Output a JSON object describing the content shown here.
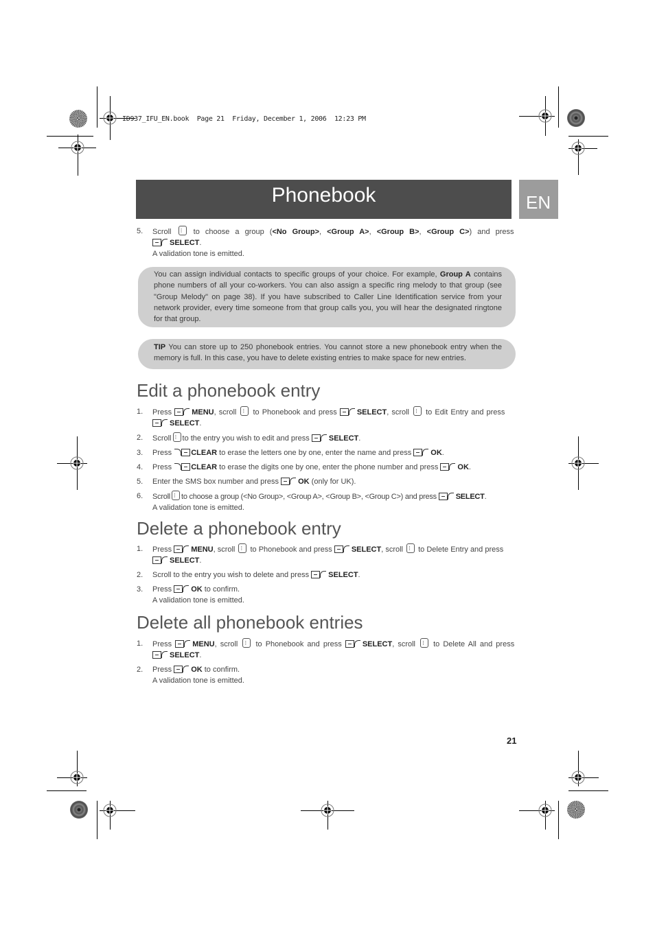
{
  "print_header": {
    "file": "ID937_IFU_EN.book",
    "page": "Page 21",
    "date": "Friday, December 1, 2006",
    "time": "12:23 PM"
  },
  "banner": {
    "title": "Phonebook",
    "lang_tab": "EN"
  },
  "keys": {
    "left_softkey_icon": "left-softkey-icon",
    "right_softkey_icon": "right-softkey-icon",
    "scroll_icon": "scroll-key-icon"
  },
  "intro_step": {
    "num": "5.",
    "t1": "Scroll",
    "t2": "to choose a group (",
    "g1": "<No Group>",
    "sep1": ", ",
    "g2": "<Group A>",
    "sep2": ", ",
    "g3": "<Group B>",
    "sep3": ", ",
    "g4": "<Group C>",
    "t3": ") and press",
    "select": "SELECT",
    "dot": ".",
    "sub": "A validation tone is emitted."
  },
  "note": {
    "t1": "You can assign individual contacts to specific groups of your choice. For example, ",
    "bold": "Group A",
    "t2": " contains phone numbers of all your co-workers. You can also assign a specific ring melody to that group (see \"Group Melody\" on page 38). If you have subscribed to Caller Line Identification service from your network provider, every time someone from that group calls you, you will hear the designated ringtone for that group."
  },
  "tip": {
    "label": "TIP",
    "text": " You can store up to 250 phonebook entries. You cannot store a new phonebook entry when the memory is full. In this case, you have to delete existing entries to make space for new entries."
  },
  "edit_section": {
    "heading": "Edit a phonebook entry",
    "steps": [
      {
        "num": "1.",
        "press": "Press",
        "menu": "MENU",
        "scroll": ", scroll",
        "to": "to Phonebook and press",
        "select": "SELECT",
        "scroll2": ", scroll",
        "to2": "to Edit Entry and press",
        "select2": "SELECT",
        "dot": "."
      },
      {
        "num": "2.",
        "t1": "Scroll",
        "t2": "to the entry you wish to edit and press",
        "select": "SELECT",
        "dot": "."
      },
      {
        "num": "3.",
        "press": "Press",
        "clear": "CLEAR",
        "t1": " to erase the letters one by one, enter the name and press",
        "ok": "OK",
        "dot": "."
      },
      {
        "num": "4.",
        "press": "Press",
        "clear": "CLEAR",
        "t1": " to erase the digits one by one, enter the phone number and press",
        "ok": "OK",
        "dot": "."
      },
      {
        "num": "5.",
        "t1": "Enter the SMS box number and press",
        "ok": "OK",
        "t2": " (only for UK)."
      },
      {
        "num": "6.",
        "t1": "Scroll",
        "t2": "to choose a group (<No Group>, <Group A>, <Group B>, <Group C>) and press",
        "select": "SELECT",
        "dot": ".",
        "sub": "A validation tone is emitted."
      }
    ]
  },
  "delete_section": {
    "heading": "Delete a phonebook entry",
    "steps": [
      {
        "num": "1.",
        "press": "Press",
        "menu": "MENU",
        "scroll": ", scroll",
        "to": "to Phonebook and press",
        "select": "SELECT",
        "scroll2": ", scroll",
        "to2": "to Delete Entry and press",
        "select2": "SELECT",
        "dot": "."
      },
      {
        "num": "2.",
        "t1": "Scroll to the entry you wish to delete and press",
        "select": "SELECT",
        "dot": "."
      },
      {
        "num": "3.",
        "press": "Press",
        "ok": "OK",
        "t1": " to confirm.",
        "sub": "A validation tone is emitted."
      }
    ]
  },
  "delete_all_section": {
    "heading": "Delete all phonebook entries",
    "steps": [
      {
        "num": "1.",
        "press": "Press",
        "menu": "MENU",
        "scroll": ", scroll",
        "to": "to Phonebook and press",
        "select": "SELECT",
        "scroll2": ", scroll",
        "to2": "to Delete All and press",
        "select2": "SELECT",
        "dot": "."
      },
      {
        "num": "2.",
        "press": "Press",
        "ok": "OK",
        "t1": " to confirm.",
        "sub": "A validation tone is emitted."
      }
    ]
  },
  "page_number": "21"
}
